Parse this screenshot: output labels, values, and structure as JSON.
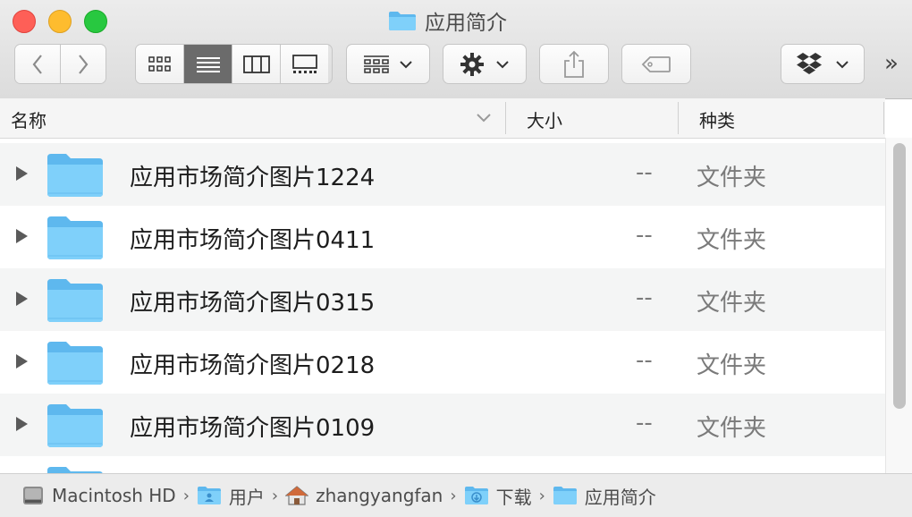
{
  "window": {
    "title": "应用简介",
    "title_icon": "folder-icon"
  },
  "toolbar": {
    "back_icon": "chevron-left-icon",
    "forward_icon": "chevron-right-icon",
    "view_modes": [
      "icon-view",
      "list-view",
      "column-view",
      "gallery-view"
    ],
    "active_view": "list-view",
    "group_icon": "group-by-icon",
    "action_icon": "gear-icon",
    "share_icon": "share-icon",
    "tag_icon": "tag-icon",
    "dropbox_icon": "dropbox-icon",
    "overflow": "»"
  },
  "columns": {
    "name": "名称",
    "size": "大小",
    "kind": "种类"
  },
  "rows": [
    {
      "name": "应用市场简介图片1224",
      "size": "--",
      "kind": "文件夹"
    },
    {
      "name": "应用市场简介图片0411",
      "size": "--",
      "kind": "文件夹"
    },
    {
      "name": "应用市场简介图片0315",
      "size": "--",
      "kind": "文件夹"
    },
    {
      "name": "应用市场简介图片0218",
      "size": "--",
      "kind": "文件夹"
    },
    {
      "name": "应用市场简介图片0109",
      "size": "--",
      "kind": "文件夹"
    }
  ],
  "pathbar": {
    "items": [
      {
        "label": "Macintosh HD",
        "icon": "hard-drive-icon"
      },
      {
        "label": "用户",
        "icon": "users-folder-icon"
      },
      {
        "label": "zhangyangfan",
        "icon": "home-icon"
      },
      {
        "label": "下载",
        "icon": "downloads-folder-icon"
      },
      {
        "label": "应用简介",
        "icon": "folder-icon"
      }
    ],
    "separator": "›"
  },
  "colors": {
    "folder": "#6fc6f6",
    "active_view": "#6b6b6b",
    "close": "#fe5f57",
    "minimize": "#febc2e",
    "maximize": "#28c840"
  }
}
